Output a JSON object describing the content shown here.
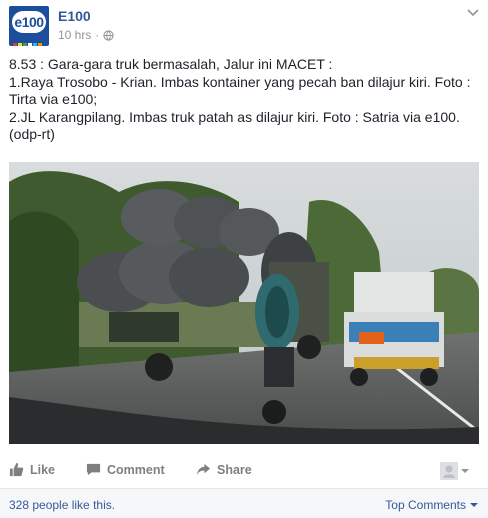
{
  "post": {
    "page_name": "E100",
    "avatar_text": "e100",
    "timestamp": "10 hrs",
    "separator": "·",
    "privacy_icon": "globe-icon",
    "menu_icon": "chevron-down-icon",
    "text": "8.53 : Gara-gara truk bermasalah, Jalur ini MACET :\n1.Raya Trosobo - Krian. Imbas kontainer yang pecah ban dilajur kiri. Foto : Tirta via e100;\n2.JL Karangpilang. Imbas truk patah as dilajur kiri. Foto : Satria via e100.(odp-rt)"
  },
  "actions": {
    "like_label": "Like",
    "comment_label": "Comment",
    "share_label": "Share",
    "like_icon": "thumbs-up-icon",
    "comment_icon": "comment-bubble-icon",
    "share_icon": "share-arrow-icon"
  },
  "footer": {
    "likes_text": "328 people like this.",
    "comments_filter": "Top Comments"
  },
  "colors": {
    "link": "#365899",
    "action_gray": "#7f7f7f",
    "brand_blue": "#1b4f9c"
  }
}
